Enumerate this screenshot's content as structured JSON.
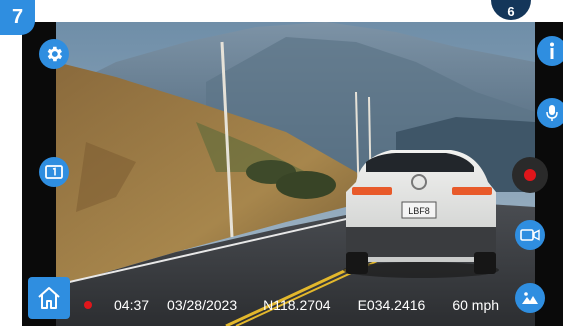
{
  "step_badge": "7",
  "corner_badge": "6",
  "status": {
    "time": "04:37",
    "date": "03/28/2023",
    "latitude": "N118.2704",
    "longitude": "E034.2416",
    "speed": "60 mph"
  },
  "license_plate": "LBF8",
  "icons": {
    "settings": "gear-icon",
    "info": "info-icon",
    "microphone": "microphone-icon",
    "record": "record-icon",
    "video": "video-camera-icon",
    "gallery": "photo-gallery-icon",
    "camera_switch": "camera-1-icon",
    "home": "home-icon"
  },
  "colors": {
    "accent": "#2f8ee0",
    "record": "#e0161b",
    "badge_dark": "#14365a"
  }
}
